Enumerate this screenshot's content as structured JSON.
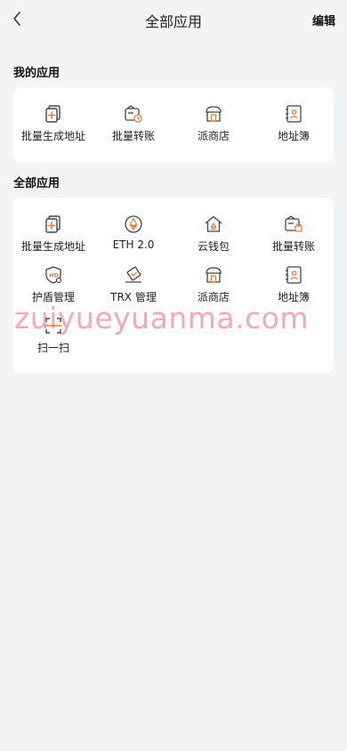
{
  "header": {
    "title": "全部应用",
    "edit_label": "编辑"
  },
  "my_apps": {
    "title": "我的应用",
    "items": [
      {
        "label": "批量生成地址",
        "icon": "batch-address-icon"
      },
      {
        "label": "批量转账",
        "icon": "batch-transfer-icon"
      },
      {
        "label": "派商店",
        "icon": "store-icon"
      },
      {
        "label": "地址簿",
        "icon": "address-book-icon"
      }
    ]
  },
  "all_apps": {
    "title": "全部应用",
    "items": [
      {
        "label": "批量生成地址",
        "icon": "batch-address-icon"
      },
      {
        "label": "ETH 2.0",
        "icon": "eth-icon"
      },
      {
        "label": "云钱包",
        "icon": "cloud-wallet-icon"
      },
      {
        "label": "批量转账",
        "icon": "batch-transfer-icon"
      },
      {
        "label": "护盾管理",
        "icon": "shield-icon"
      },
      {
        "label": "TRX 管理",
        "icon": "trx-icon"
      },
      {
        "label": "派商店",
        "icon": "store-icon"
      },
      {
        "label": "地址簿",
        "icon": "address-book-icon"
      },
      {
        "label": "扫一扫",
        "icon": "scan-icon"
      }
    ]
  },
  "watermark": "zuiyueyuanma.com",
  "colors": {
    "accent": "#f07a3a",
    "icon_stroke": "#444444",
    "background": "#f3f4f6",
    "card": "#ffffff"
  }
}
